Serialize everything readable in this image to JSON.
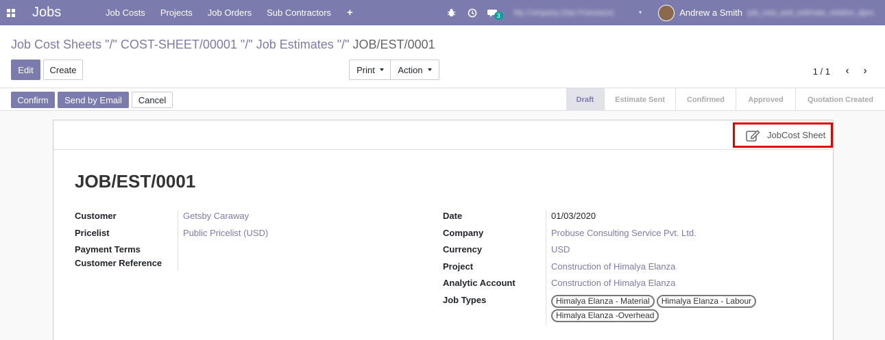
{
  "navbar": {
    "brand": "Jobs",
    "menu": [
      "Job Costs",
      "Projects",
      "Job Orders",
      "Sub Contractors"
    ],
    "plus": "+",
    "messages_badge": "3",
    "company_blurred": "My Company (San Francisco)",
    "user_name": "Andrew a Smith",
    "db_blurred": "job_cost_and_estimate_relation_dpro"
  },
  "breadcrumb": {
    "parts": [
      "Job Cost Sheets \"/\" COST-SHEET/00001 \"/\" Job Estimates \"/\" "
    ],
    "active": "JOB/EST/0001"
  },
  "toolbar": {
    "edit": "Edit",
    "create": "Create",
    "print": "Print",
    "action": "Action",
    "pager_value": "1 / 1"
  },
  "statusbar": {
    "confirm": "Confirm",
    "send_email": "Send by Email",
    "cancel": "Cancel",
    "stages": [
      "Draft",
      "Estimate Sent",
      "Confirmed",
      "Approved",
      "Quotation Created"
    ],
    "active_stage": "Draft"
  },
  "sheet": {
    "smart_button": "JobCost Sheet",
    "title": "JOB/EST/0001",
    "left": {
      "customer_label": "Customer",
      "customer": "Getsby Caraway",
      "pricelist_label": "Pricelist",
      "pricelist": "Public Pricelist (USD)",
      "payment_terms_label": "Payment Terms",
      "customer_ref_label": "Customer Reference"
    },
    "right": {
      "date_label": "Date",
      "date": "01/03/2020",
      "company_label": "Company",
      "company": "Probuse Consulting Service Pvt. Ltd.",
      "currency_label": "Currency",
      "currency": "USD",
      "project_label": "Project",
      "project": "Construction of Himalya Elanza",
      "analytic_label": "Analytic Account",
      "analytic": "Construction of Himalya Elanza",
      "job_types_label": "Job Types",
      "job_types": [
        "Himalya Elanza - Material",
        "Himalya Elanza - Labour",
        "Himalya Elanza -Overhead"
      ]
    }
  },
  "colors": {
    "primary": "#7c7bad",
    "highlight_border": "#e00000",
    "badge": "#00a09d"
  }
}
